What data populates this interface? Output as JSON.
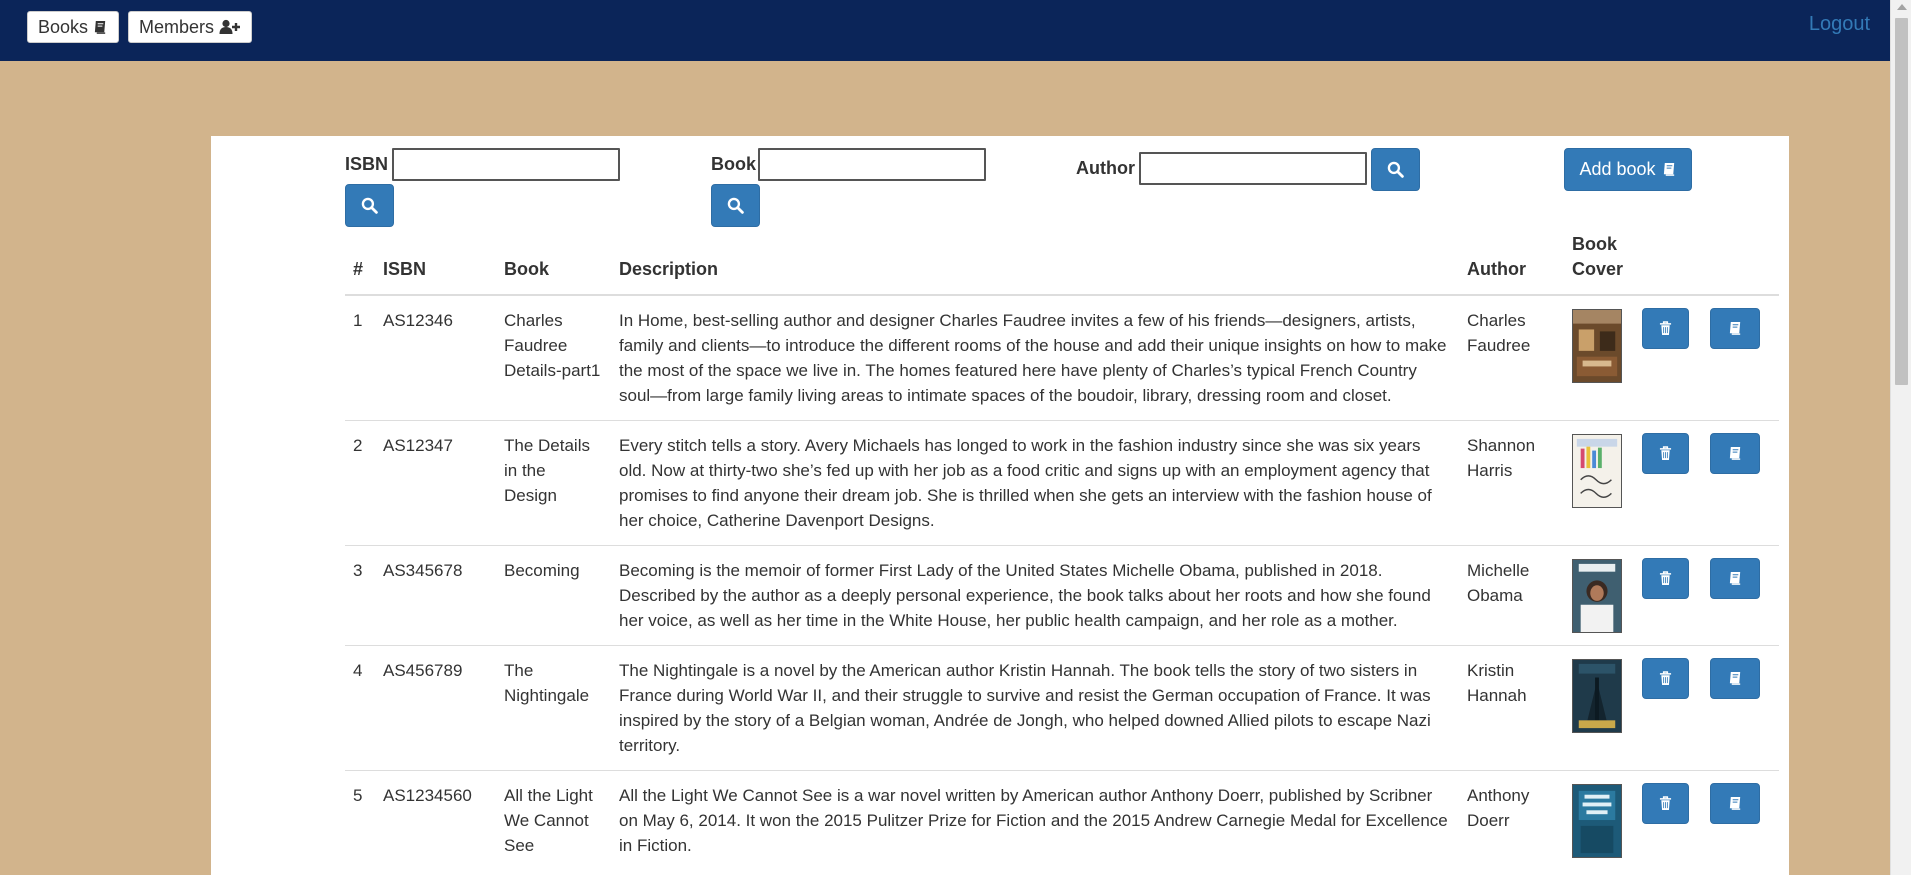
{
  "nav": {
    "books_label": "Books",
    "members_label": "Members",
    "logout_label": "Logout"
  },
  "search": {
    "isbn_label": "ISBN",
    "book_label": "Book",
    "author_label": "Author",
    "isbn_value": "",
    "book_value": "",
    "author_value": "",
    "add_book_label": "Add book"
  },
  "table": {
    "headers": {
      "num": "#",
      "isbn": "ISBN",
      "book": "Book",
      "description": "Description",
      "author": "Author",
      "cover_line1": "Book",
      "cover_line2": "Cover"
    },
    "rows": [
      {
        "num": "1",
        "isbn": "AS12346",
        "book": "Charles Faudree Details-part1",
        "description": "In Home, best-selling author and designer Charles Faudree invites a few of his friends—designers, artists, family and clients—to introduce the different rooms of the house and add their unique insights on how to make the most of the space we live in. The homes featured here have plenty of Charles’s typical French Country soul—from large family living areas to intimate spaces of the boudoir, library, dressing room and closet.",
        "author": "Charles Faudree"
      },
      {
        "num": "2",
        "isbn": "AS12347",
        "book": "The Details in the Design",
        "description": "Every stitch tells a story. Avery Michaels has longed to work in the fashion industry since she was six years old. Now at thirty-two she’s fed up with her job as a food critic and signs up with an employment agency that promises to find anyone their dream job. She is thrilled when she gets an interview with the fashion house of her choice, Catherine Davenport Designs.",
        "author": "Shannon Harris"
      },
      {
        "num": "3",
        "isbn": "AS345678",
        "book": "Becoming",
        "description": "Becoming is the memoir of former First Lady of the United States Michelle Obama, published in 2018. Described by the author as a deeply personal experience, the book talks about her roots and how she found her voice, as well as her time in the White House, her public health campaign, and her role as a mother.",
        "author": "Michelle Obama"
      },
      {
        "num": "4",
        "isbn": "AS456789",
        "book": "The Nightingale",
        "description": "The Nightingale is a novel by the American author Kristin Hannah. The book tells the story of two sisters in France during World War II, and their struggle to survive and resist the German occupation of France. It was inspired by the story of a Belgian woman, Andrée de Jongh, who helped downed Allied pilots to escape Nazi territory.",
        "author": "Kristin Hannah"
      },
      {
        "num": "5",
        "isbn": "AS1234560",
        "book": "All the Light We Cannot See",
        "description": "All the Light We Cannot See is a war novel written by American author Anthony Doerr, published by Scribner on May 6, 2014. It won the 2015 Pulitzer Prize for Fiction and the 2015 Andrew Carnegie Medal for Excellence in Fiction.",
        "author": "Anthony Doerr"
      }
    ]
  },
  "colors": {
    "navbar": "#0b2559",
    "page_background": "#d2b48c",
    "primary_button": "#337ab7",
    "link": "#337ab7"
  },
  "icons": {
    "books": "book-icon",
    "members": "user-plus-icon",
    "search": "search-icon",
    "delete": "trash-icon",
    "edit": "book-icon"
  }
}
